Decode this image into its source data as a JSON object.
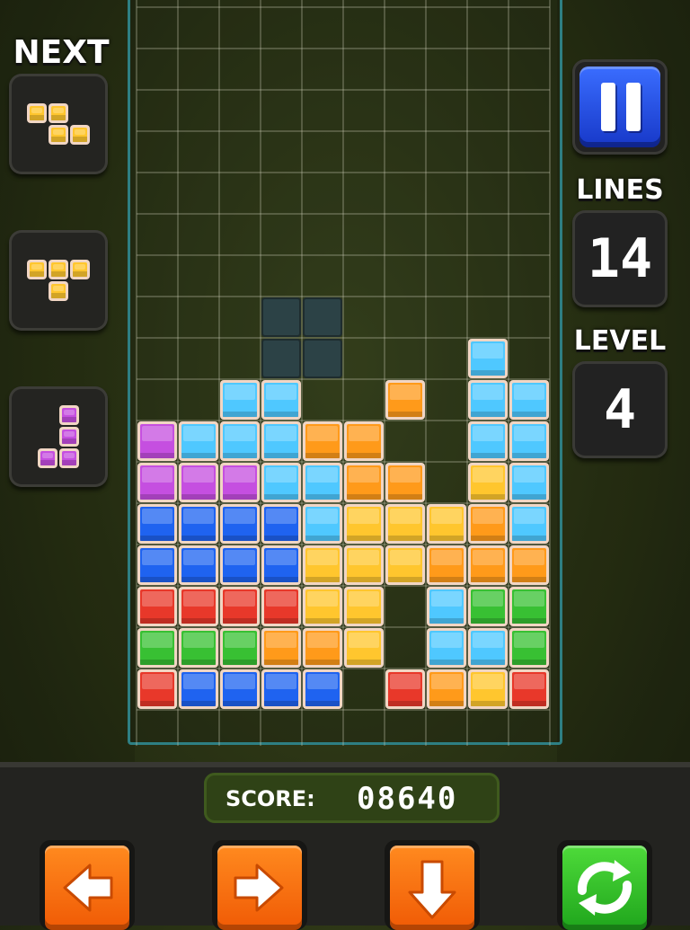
{
  "next": {
    "title": "NEXT",
    "queue": [
      {
        "name": "Z piece",
        "color": "yellow",
        "cells": [
          [
            0,
            0
          ],
          [
            1,
            0
          ],
          [
            1,
            1
          ],
          [
            2,
            1
          ]
        ]
      },
      {
        "name": "T piece",
        "color": "yellow",
        "cells": [
          [
            0,
            0
          ],
          [
            1,
            0
          ],
          [
            2,
            0
          ],
          [
            1,
            1
          ]
        ]
      },
      {
        "name": "J piece",
        "color": "purple",
        "cells": [
          [
            1,
            0
          ],
          [
            1,
            1
          ],
          [
            0,
            2
          ],
          [
            1,
            2
          ]
        ]
      }
    ]
  },
  "stats": {
    "lines_label": "LINES",
    "lines_value": "14",
    "level_label": "LEVEL",
    "level_value": "4"
  },
  "score": {
    "label": "SCORE:",
    "value": "08640"
  },
  "controls": {
    "pause": "pause-icon",
    "left": "arrow-left-icon",
    "right": "arrow-right-icon",
    "down": "arrow-down-icon",
    "rotate": "rotate-icon"
  },
  "board": {
    "cols": 10,
    "rows": 18,
    "legend": {
      "c": "cyan",
      "p": "purple",
      "o": "orange",
      "y": "yellow",
      "b": "blue",
      "r": "red",
      "g": "green",
      "s": "ghost"
    },
    "grid": [
      "..........",
      "..........",
      "..........",
      "..........",
      "..........",
      "..........",
      "..........",
      "...ss.....",
      "...ss...c.",
      "..cc..o.cc",
      "pcccoo..cc",
      "pppccoo.yc",
      "bbbbcyyyoc",
      "bbbbyyyooo",
      "rrrryy.cgg",
      "gggooy.ccg",
      "rbbbb.royr",
      ".........."
    ]
  },
  "colors": {
    "cyan": "#4fc8ff",
    "purple": "#c54fe0",
    "orange": "#ff9a1a",
    "yellow": "#ffc62e",
    "blue": "#1f63f0",
    "red": "#e8382a",
    "green": "#38c033",
    "ghost": "#2c4246",
    "frame": "#2e7f83"
  }
}
